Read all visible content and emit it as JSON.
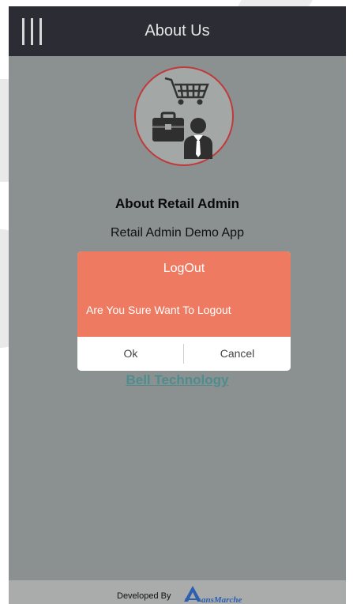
{
  "appbar": {
    "title": "About Us",
    "menu_icon": "hamburger-menu-icon"
  },
  "about": {
    "logo_icon": "retail-admin-logo-icon",
    "title": "About Retail Admin",
    "subtitle": "Retail Admin Demo App",
    "company_link": "Bell Technology"
  },
  "dialog": {
    "title": "LogOut",
    "message": "Are You Sure Want To Logout",
    "ok_label": "Ok",
    "cancel_label": "Cancel",
    "header_color": "#ef7a62"
  },
  "footer": {
    "developed_by": "Developed By",
    "brand_text": "ansMarche"
  },
  "colors": {
    "appbar": "#2c2c34",
    "overlay_background": "#8a9190",
    "link": "#4f8c8e",
    "brand": "#2d5fb0"
  }
}
